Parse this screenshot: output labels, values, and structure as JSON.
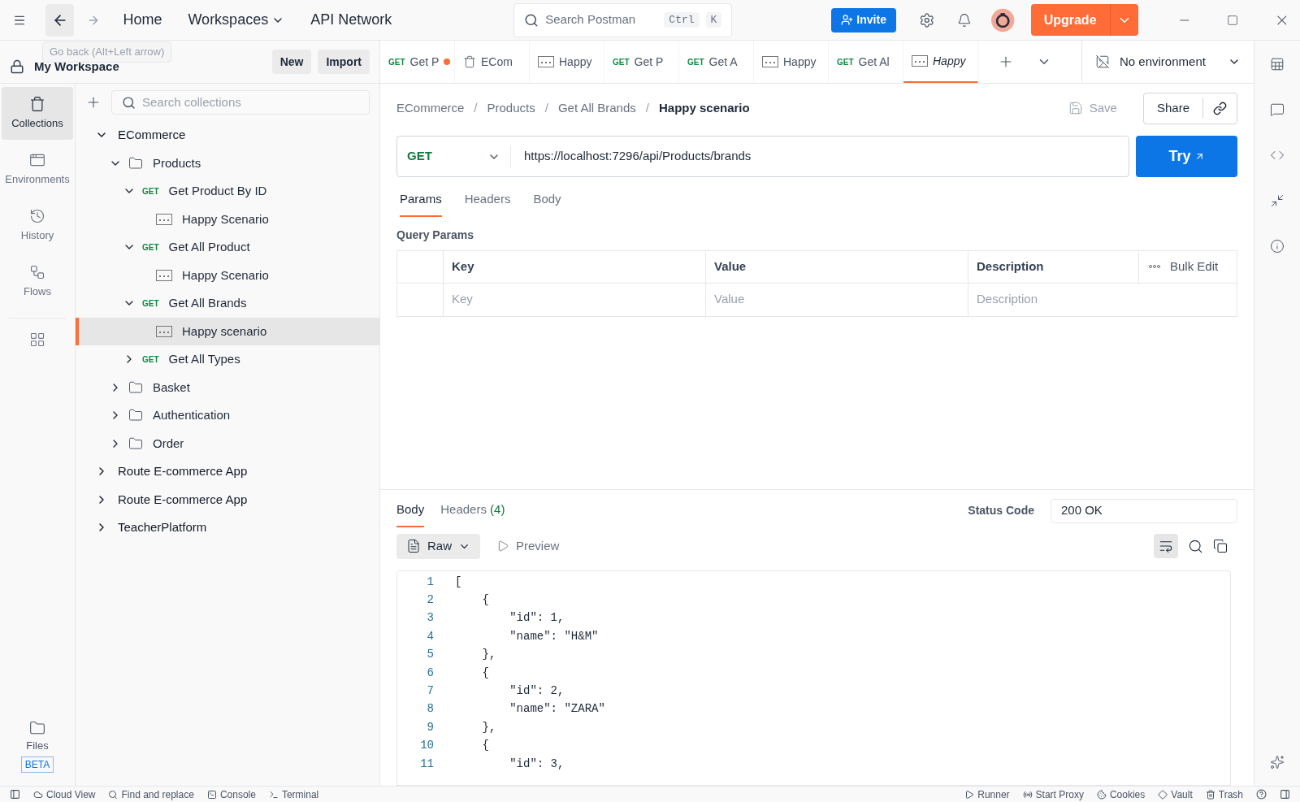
{
  "top_bar": {
    "nav": [
      {
        "label": "Home",
        "dropdown": false
      },
      {
        "label": "Workspaces",
        "dropdown": true
      },
      {
        "label": "API Network",
        "dropdown": false
      }
    ],
    "search": {
      "placeholder": "Search Postman",
      "keys": [
        "Ctrl",
        "K"
      ]
    },
    "invite": "Invite",
    "upgrade": "Upgrade"
  },
  "tooltip": "Go back (Alt+Left arrow)",
  "workspace": {
    "name": "My Workspace",
    "buttons": [
      "New",
      "Import"
    ]
  },
  "rail": [
    {
      "kind": "collections",
      "label": "Collections",
      "selected": true
    },
    {
      "kind": "environments",
      "label": "Environments",
      "selected": false
    },
    {
      "kind": "history",
      "label": "History",
      "selected": false
    },
    {
      "kind": "flows",
      "label": "Flows",
      "selected": false
    }
  ],
  "files": {
    "label": "Files",
    "badge": "BETA"
  },
  "collections_search": {
    "placeholder": "Search collections"
  },
  "tree": [
    {
      "kind": "collection",
      "label": "ECommerce",
      "expanded": true,
      "selected": false,
      "children": [
        {
          "kind": "folder",
          "label": "Products",
          "expanded": true,
          "selected": false,
          "children": [
            {
              "kind": "request",
              "method": "GET",
              "label": "Get Product By ID",
              "expanded": true,
              "selected": false,
              "children": [
                {
                  "kind": "example",
                  "label": "Happy Scenario",
                  "selected": false
                }
              ]
            },
            {
              "kind": "request",
              "method": "GET",
              "label": "Get All Product",
              "expanded": true,
              "selected": false,
              "children": [
                {
                  "kind": "example",
                  "label": "Happy Scenario",
                  "selected": false
                }
              ]
            },
            {
              "kind": "request",
              "method": "GET",
              "label": "Get All Brands",
              "expanded": true,
              "selected": false,
              "children": [
                {
                  "kind": "example",
                  "label": "Happy scenario",
                  "selected": true
                }
              ]
            },
            {
              "kind": "request",
              "method": "GET",
              "label": "Get All Types",
              "expanded": false,
              "selected": false
            }
          ]
        },
        {
          "kind": "folder",
          "label": "Basket",
          "expanded": false,
          "selected": false
        },
        {
          "kind": "folder",
          "label": "Authentication",
          "expanded": false,
          "selected": false
        },
        {
          "kind": "folder",
          "label": "Order",
          "expanded": false,
          "selected": false
        }
      ]
    },
    {
      "kind": "collection",
      "label": "Route E-commerce App",
      "expanded": false,
      "selected": false
    },
    {
      "kind": "collection",
      "label": "Route E-commerce App",
      "expanded": false,
      "selected": false
    },
    {
      "kind": "collection",
      "label": "TeacherPlatform",
      "expanded": false,
      "selected": false
    }
  ],
  "tabs": [
    {
      "kind": "request",
      "method": "GET",
      "label": "Get P",
      "unsaved": true,
      "selected": false
    },
    {
      "kind": "collection",
      "label": "ECom",
      "unsaved": false,
      "selected": false
    },
    {
      "kind": "example",
      "label": "Happy",
      "unsaved": false,
      "selected": false
    },
    {
      "kind": "request",
      "method": "GET",
      "label": "Get P",
      "unsaved": false,
      "selected": false
    },
    {
      "kind": "request",
      "method": "GET",
      "label": "Get A",
      "unsaved": false,
      "selected": false
    },
    {
      "kind": "example",
      "label": "Happy",
      "unsaved": false,
      "selected": false
    },
    {
      "kind": "request",
      "method": "GET",
      "label": "Get Al",
      "unsaved": false,
      "selected": false
    },
    {
      "kind": "example",
      "label": "Happy",
      "unsaved": false,
      "selected": true
    }
  ],
  "environment": "No environment",
  "breadcrumb": [
    {
      "kind": "link",
      "label": "ECommerce"
    },
    {
      "kind": "separator",
      "label": "/"
    },
    {
      "kind": "link",
      "label": "Products"
    },
    {
      "kind": "separator",
      "label": "/"
    },
    {
      "kind": "link",
      "label": "Get All Brands"
    },
    {
      "kind": "separator",
      "label": "/"
    },
    {
      "kind": "current",
      "label": "Happy scenario"
    }
  ],
  "save": "Save",
  "share": "Share",
  "request": {
    "method": "GET",
    "url": "https://localhost:7296/api/Products/brands",
    "send": "Try"
  },
  "request_tabs": [
    {
      "label": "Params",
      "selected": true
    },
    {
      "label": "Headers",
      "selected": false
    },
    {
      "label": "Body",
      "selected": false
    }
  ],
  "query_params": {
    "title": "Query Params",
    "columns": [
      "Key",
      "Value",
      "Description"
    ],
    "bulk_edit": "Bulk Edit",
    "placeholders": [
      "Key",
      "Value",
      "Description"
    ]
  },
  "response": {
    "tabs": [
      {
        "label": "Body",
        "selected": true
      },
      {
        "label": "Headers",
        "count": "(4)",
        "selected": false
      }
    ],
    "status_label": "Status Code",
    "status": "200 OK",
    "format": "Raw",
    "preview": "Preview",
    "lines": [
      {
        "number": "1",
        "text": "["
      },
      {
        "number": "2",
        "text": "    {"
      },
      {
        "number": "3",
        "text": "        \"id\": 1,"
      },
      {
        "number": "4",
        "text": "        \"name\": \"H&M\""
      },
      {
        "number": "5",
        "text": "    },"
      },
      {
        "number": "6",
        "text": "    {"
      },
      {
        "number": "7",
        "text": "        \"id\": 2,"
      },
      {
        "number": "8",
        "text": "        \"name\": \"ZARA\""
      },
      {
        "number": "9",
        "text": "    },"
      },
      {
        "number": "10",
        "text": "    {"
      },
      {
        "number": "11",
        "text": "        \"id\": 3,"
      }
    ]
  },
  "status_bar": {
    "left": [
      "Cloud View",
      "Find and replace",
      "Console",
      "Terminal"
    ],
    "right": [
      "Runner",
      "Start Proxy",
      "Cookies",
      "Vault",
      "Trash"
    ]
  }
}
